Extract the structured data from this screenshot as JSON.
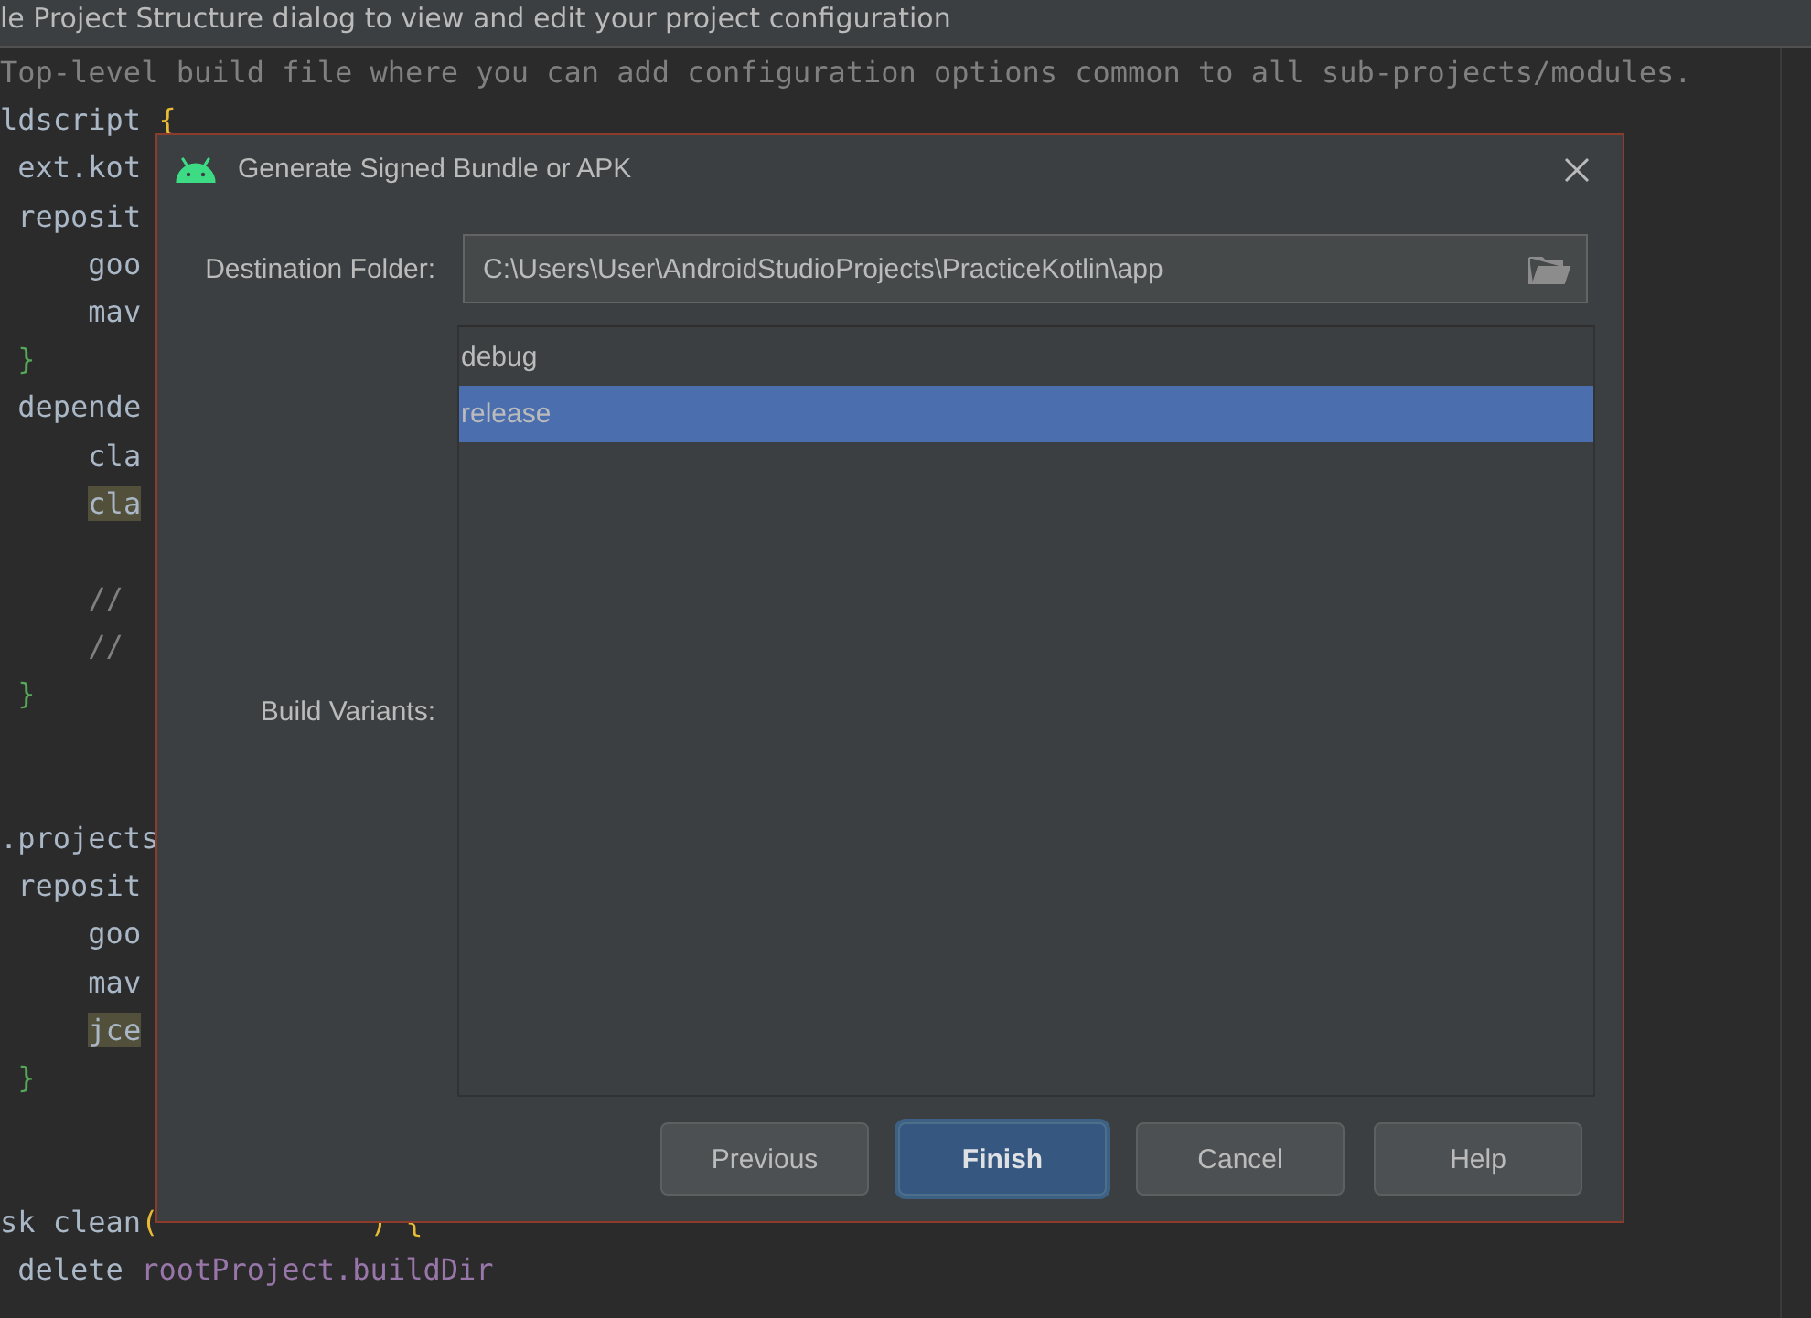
{
  "top_bar": {
    "text": "le Project Structure dialog to view and edit your project configuration"
  },
  "editor": {
    "sections": [
      {
        "lines": [
          {
            "tokens": [
              {
                "text": "Top-level build file where you can add configuration options common to all sub-projects/modules.",
                "kind": "comment"
              }
            ]
          },
          {
            "tokens": [
              {
                "text": "ldscript ",
                "kind": "plain"
              },
              {
                "text": "{",
                "kind": "bracket"
              }
            ]
          },
          {
            "tokens": [
              {
                "text": " ext.kot",
                "kind": "plain"
              }
            ]
          },
          {
            "tokens": [
              {
                "text": " reposit",
                "kind": "plain"
              }
            ]
          },
          {
            "tokens": [
              {
                "text": "     goo",
                "kind": "plain"
              }
            ]
          },
          {
            "tokens": [
              {
                "text": "     mav",
                "kind": "plain"
              }
            ]
          },
          {
            "tokens": [
              {
                "text": " }",
                "kind": "block_brace"
              }
            ]
          },
          {
            "tokens": [
              {
                "text": " depende",
                "kind": "plain"
              }
            ]
          },
          {
            "tokens": [
              {
                "text": "     cla",
                "kind": "plain"
              }
            ]
          },
          {
            "tokens": [
              {
                "text": "     cla",
                "kind": "marked"
              }
            ]
          }
        ]
      },
      {
        "lines": [
          {
            "tokens": [
              {
                "text": "     //",
                "kind": "comment"
              }
            ]
          },
          {
            "tokens": [
              {
                "text": "     //",
                "kind": "comment"
              }
            ]
          },
          {
            "tokens": [
              {
                "text": " }",
                "kind": "block_brace"
              }
            ]
          }
        ]
      },
      {
        "lines": [
          {
            "tokens": [
              {
                "text": ".projects",
                "kind": "plain"
              }
            ]
          },
          {
            "tokens": [
              {
                "text": " reposit",
                "kind": "plain"
              }
            ]
          },
          {
            "tokens": [
              {
                "text": "     goo",
                "kind": "plain"
              }
            ]
          },
          {
            "tokens": [
              {
                "text": "     mav",
                "kind": "plain"
              }
            ]
          },
          {
            "tokens": [
              {
                "text": "     jce",
                "kind": "marked"
              }
            ]
          },
          {
            "tokens": [
              {
                "text": " }",
                "kind": "block_brace"
              }
            ]
          }
        ]
      },
      {
        "lines": [
          {
            "tokens": [
              {
                "text": "sk clean",
                "kind": "plain"
              },
              {
                "text": "(",
                "kind": "bracket"
              },
              {
                "text": ")",
                "kind": "bracket",
                "gap_before": true
              },
              {
                "text": "{",
                "kind": "bracket"
              }
            ]
          },
          {
            "tokens": [
              {
                "text": " delete ",
                "kind": "plain"
              },
              {
                "text": "rootProject.buildDir",
                "kind": "field"
              }
            ]
          }
        ]
      }
    ]
  },
  "dialog": {
    "title": "Generate Signed Bundle or APK",
    "destination": {
      "label": "Destination Folder:",
      "value": "C:\\Users\\User\\AndroidStudioProjects\\PracticeKotlin\\app"
    },
    "build_variants": {
      "label": "Build Variants:",
      "items": [
        {
          "label": "debug",
          "selected": false
        },
        {
          "label": "release",
          "selected": true
        }
      ]
    },
    "buttons": [
      {
        "label": "Previous",
        "default": false
      },
      {
        "label": "Finish",
        "default": true
      },
      {
        "label": "Cancel",
        "default": false
      },
      {
        "label": "Help",
        "default": false
      }
    ]
  }
}
